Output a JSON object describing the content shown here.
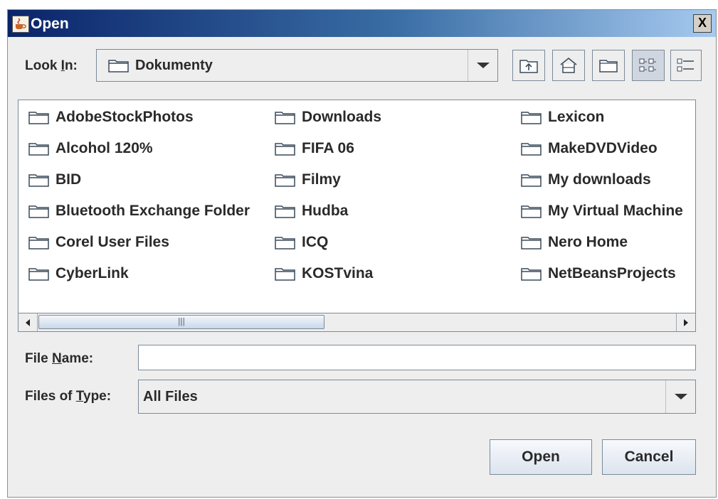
{
  "window": {
    "title": "Open",
    "close_label": "X"
  },
  "look_in": {
    "label_pre": "Look ",
    "label_mnemonic": "I",
    "label_post": "n:",
    "value": "Dokumenty"
  },
  "toolbar": {
    "buttons": [
      {
        "name": "up-one-level-button",
        "icon": "up-folder-icon"
      },
      {
        "name": "home-button",
        "icon": "home-icon"
      },
      {
        "name": "new-folder-button",
        "icon": "new-folder-icon"
      },
      {
        "name": "list-view-button",
        "icon": "list-view-icon",
        "pressed": true
      },
      {
        "name": "details-view-button",
        "icon": "details-view-icon"
      }
    ]
  },
  "files": {
    "columns": [
      [
        "AdobeStockPhotos",
        "Alcohol 120%",
        "BID",
        "Bluetooth Exchange Folder",
        "Corel User Files",
        "CyberLink"
      ],
      [
        "Downloads",
        "FIFA 06",
        "Filmy",
        "Hudba",
        "ICQ",
        "KOSTvina"
      ],
      [
        "Lexicon",
        "MakeDVDVideo",
        "My downloads",
        "My Virtual Machine",
        "Nero Home",
        "NetBeansProjects"
      ]
    ]
  },
  "file_name": {
    "label_pre": "File ",
    "label_mnemonic": "N",
    "label_post": "ame:",
    "value": ""
  },
  "file_type": {
    "label_pre": "Files of ",
    "label_mnemonic": "T",
    "label_post": "ype:",
    "value": "All Files"
  },
  "buttons": {
    "open": "Open",
    "cancel": "Cancel"
  }
}
